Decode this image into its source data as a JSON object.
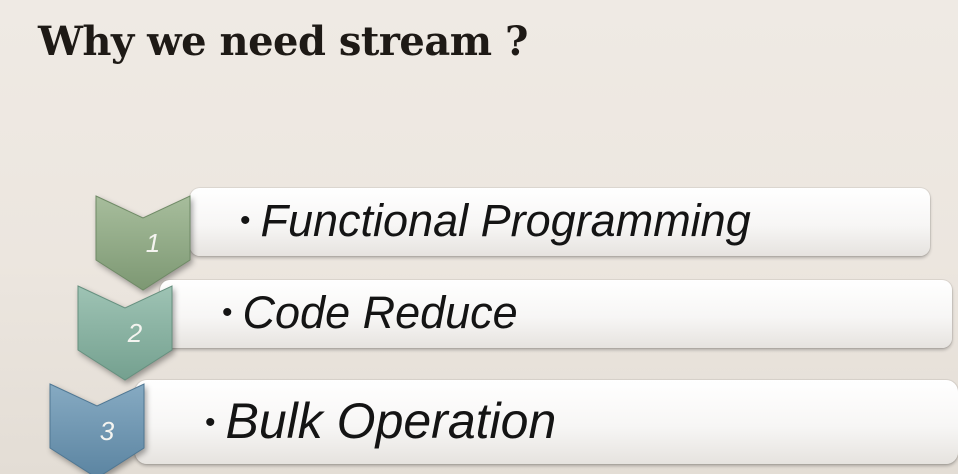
{
  "title": "Why we need stream ?",
  "items": [
    {
      "number": "1",
      "bullet": "•",
      "label": "Functional Programming",
      "color": "#8fa885"
    },
    {
      "number": "2",
      "bullet": "•",
      "label": "Code Reduce",
      "color": "#86ad9f"
    },
    {
      "number": "3",
      "bullet": "•",
      "label": "Bulk Operation",
      "color": "#6b93ae"
    }
  ]
}
